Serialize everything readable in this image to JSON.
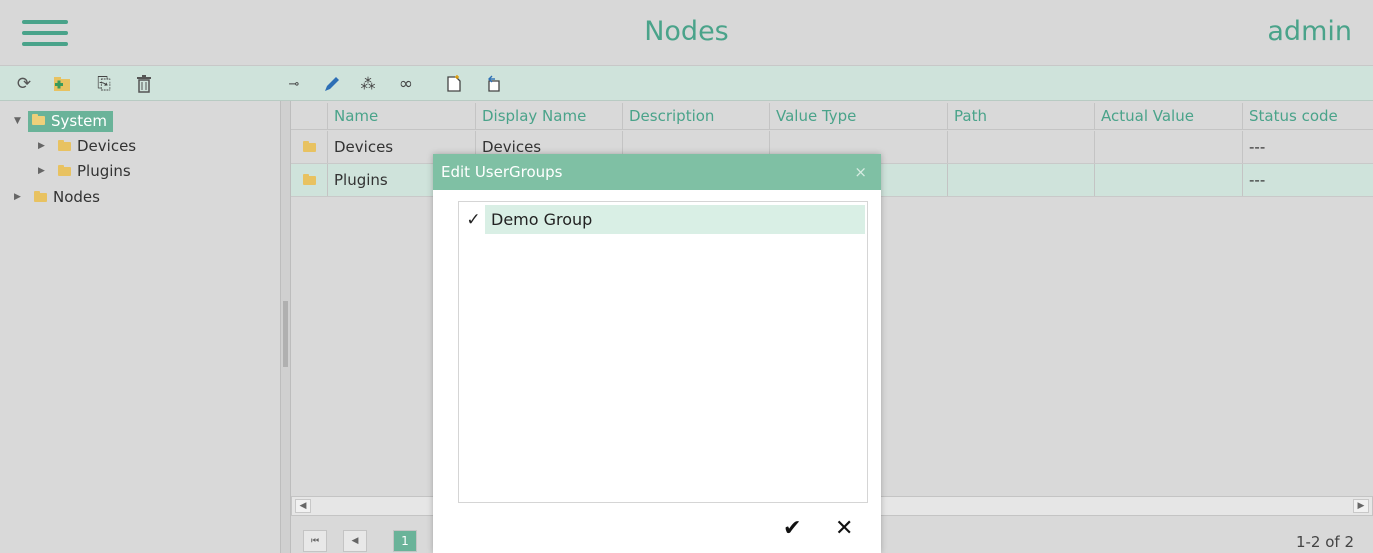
{
  "header": {
    "title": "Nodes",
    "user": "admin"
  },
  "toolbar": {
    "left": [
      {
        "icon": "refresh-icon",
        "glyph": "⟳"
      },
      {
        "icon": "add-folder-icon",
        "glyph": "▰"
      },
      {
        "icon": "import-icon",
        "glyph": "⎘"
      },
      {
        "icon": "trash-icon",
        "glyph": "🗑"
      }
    ],
    "right": [
      {
        "icon": "key-icon",
        "glyph": "⊸"
      },
      {
        "icon": "pencil-icon",
        "glyph": "✎"
      },
      {
        "icon": "users-icon",
        "glyph": "⁂"
      },
      {
        "icon": "link-icon",
        "glyph": "∞"
      },
      {
        "icon": "new-document-icon",
        "glyph": "▯"
      },
      {
        "icon": "export-icon",
        "glyph": "⇱"
      }
    ]
  },
  "tree": {
    "items": [
      {
        "label": "System",
        "selected": true
      },
      {
        "label": "Devices"
      },
      {
        "label": "Plugins"
      },
      {
        "label": "Nodes"
      }
    ]
  },
  "grid": {
    "columns": [
      "Name",
      "Display Name",
      "Description",
      "Value Type",
      "Path",
      "Actual Value",
      "Status code"
    ],
    "rows": [
      {
        "name": "Devices",
        "display": "Devices",
        "description": "",
        "valueType": "",
        "path": "",
        "actual": "",
        "status": "---"
      },
      {
        "name": "Plugins",
        "display": "",
        "description": "",
        "valueType": "",
        "path": "",
        "actual": "",
        "status": "---"
      }
    ],
    "pager": {
      "current": "1",
      "info": "1-2 of 2"
    }
  },
  "dialog": {
    "title": "Edit UserGroups",
    "close": "×",
    "items": [
      {
        "label": "Demo Group",
        "checked": "✓"
      }
    ],
    "ok": "✔",
    "cancel": "✕"
  },
  "colors": {
    "accent": "#4aa38a",
    "toolbar": "#cfe3db",
    "selected": "#6ab399",
    "folder": "#e8c261"
  }
}
